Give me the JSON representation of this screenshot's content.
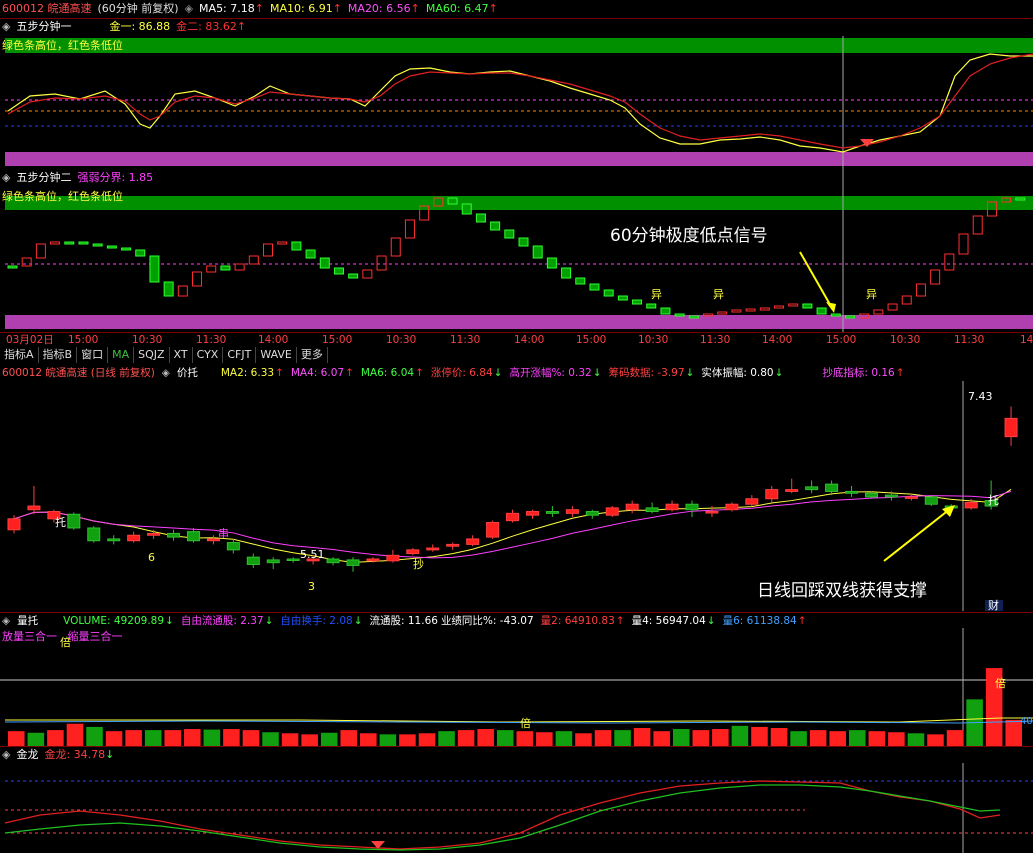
{
  "top_header": {
    "code": "600012 皖通高速",
    "period": "(60分钟 前复权)",
    "ma5": "MA5: 7.18",
    "ma10": "MA10: 6.91",
    "ma20": "MA20: 6.56",
    "ma60": "MA60: 6.47"
  },
  "pane1": {
    "title": "五步分钟一",
    "jin1": "金一: 86.88",
    "jin2": "金二: 83.62",
    "note": "绿色条高位，红色条低位"
  },
  "pane2": {
    "title": "五步分钟二",
    "strong": "强弱分界: 1.85",
    "note": "绿色条高位，红色条低位",
    "annotation": "60分钟极度低点信号",
    "marks": [
      "异",
      "异",
      "异"
    ]
  },
  "time_axis": [
    "03月02日",
    "15:00",
    "10:30",
    "11:30",
    "14:00",
    "15:00",
    "10:30",
    "11:30",
    "14:00",
    "15:00",
    "10:30",
    "11:30",
    "14:00",
    "15:00",
    "10:30",
    "11:30",
    "14"
  ],
  "tabs": [
    "指标A",
    "指标B",
    "窗口",
    "MA",
    "SQJZ",
    "XT",
    "CYX",
    "CFJT",
    "WAVE",
    "更多"
  ],
  "main_header": {
    "code": "600012 皖通高速 (日线 前复权)",
    "pt": "价托",
    "ma2": "MA2: 6.33",
    "ma4": "MA4: 6.07",
    "ma6": "MA6: 6.04",
    "zt": "涨停价: 6.84",
    "gk": "高开涨幅%: 0.32",
    "cm": "筹码数据: -3.97",
    "st": "实体振幅: 0.80",
    "cd": "抄底指标: 0.16"
  },
  "main_labels": {
    "high": "7.43",
    "low": "5.51",
    "t1": "托",
    "t2": "托",
    "chuan": "串",
    "chao": "抄",
    "n6": "6",
    "n3": "3",
    "cai": "财",
    "annotation": "日线回踩双线获得支撑"
  },
  "vol_header": {
    "title": "量托",
    "volume": "VOLUME: 49209.89",
    "ziyou": "自由流通股: 2.37",
    "huanshou": "自由换手: 2.08",
    "liutong": "流通股: 11.66",
    "yeji": "业绩同比%: -43.07",
    "l2": "量2: 64910.83",
    "l4": "量4: 56947.04",
    "l6": "量6: 61138.84",
    "sub": "放量三合一 , 缩量三合一",
    "bei1": "倍",
    "bei2": "倍",
    "bei3": "倍",
    "val40": "40"
  },
  "jl_header": {
    "title": "金龙",
    "jl": "金龙: 34.78"
  },
  "chart_data": {
    "type": "candlestick",
    "title": "600012 皖通高速 (日线 前复权)",
    "price_range": [
      5.3,
      7.6
    ],
    "daily_candles": [
      [
        6.08,
        6.2,
        6.04,
        6.24
      ],
      [
        6.3,
        6.34,
        6.25,
        6.56
      ],
      [
        6.2,
        6.28,
        6.16,
        6.3
      ],
      [
        6.25,
        6.1,
        6.08,
        6.27
      ],
      [
        6.1,
        5.96,
        5.94,
        6.12
      ],
      [
        5.98,
        5.96,
        5.92,
        6.02
      ],
      [
        5.96,
        6.02,
        5.94,
        6.06
      ],
      [
        6.02,
        6.04,
        5.98,
        6.08
      ],
      [
        6.04,
        6.0,
        5.96,
        6.08
      ],
      [
        6.06,
        5.96,
        5.94,
        6.1
      ],
      [
        5.96,
        5.98,
        5.92,
        6.02
      ],
      [
        5.94,
        5.86,
        5.82,
        5.98
      ],
      [
        5.78,
        5.7,
        5.66,
        5.82
      ],
      [
        5.75,
        5.72,
        5.65,
        5.78
      ],
      [
        5.76,
        5.75,
        5.72,
        5.78
      ],
      [
        5.74,
        5.76,
        5.7,
        5.8
      ],
      [
        5.76,
        5.72,
        5.69,
        5.78
      ],
      [
        5.75,
        5.69,
        5.62,
        5.78
      ],
      [
        5.74,
        5.76,
        5.72,
        5.78
      ],
      [
        5.74,
        5.8,
        5.72,
        5.86
      ],
      [
        5.82,
        5.86,
        5.8,
        5.88
      ],
      [
        5.86,
        5.88,
        5.84,
        5.92
      ],
      [
        5.9,
        5.92,
        5.86,
        5.94
      ],
      [
        5.92,
        5.98,
        5.9,
        6.02
      ],
      [
        6.0,
        6.16,
        5.98,
        6.18
      ],
      [
        6.18,
        6.26,
        6.16,
        6.3
      ],
      [
        6.24,
        6.28,
        6.2,
        6.3
      ],
      [
        6.28,
        6.26,
        6.22,
        6.34
      ],
      [
        6.26,
        6.3,
        6.22,
        6.34
      ],
      [
        6.28,
        6.24,
        6.2,
        6.3
      ],
      [
        6.24,
        6.32,
        6.22,
        6.34
      ],
      [
        6.3,
        6.36,
        6.26,
        6.4
      ],
      [
        6.32,
        6.28,
        6.26,
        6.38
      ],
      [
        6.3,
        6.36,
        6.28,
        6.4
      ],
      [
        6.36,
        6.3,
        6.22,
        6.4
      ],
      [
        6.28,
        6.28,
        6.22,
        6.34
      ],
      [
        6.3,
        6.36,
        6.28,
        6.38
      ],
      [
        6.36,
        6.42,
        6.34,
        6.46
      ],
      [
        6.42,
        6.52,
        6.38,
        6.56
      ],
      [
        6.5,
        6.52,
        6.48,
        6.64
      ],
      [
        6.55,
        6.52,
        6.48,
        6.62
      ],
      [
        6.58,
        6.5,
        6.46,
        6.62
      ],
      [
        6.5,
        6.48,
        6.44,
        6.56
      ],
      [
        6.48,
        6.44,
        6.42,
        6.5
      ],
      [
        6.46,
        6.44,
        6.4,
        6.5
      ],
      [
        6.44,
        6.44,
        6.4,
        6.48
      ],
      [
        6.44,
        6.36,
        6.34,
        6.46
      ],
      [
        6.34,
        6.32,
        6.3,
        6.36
      ],
      [
        6.32,
        6.38,
        6.3,
        6.42
      ],
      [
        6.4,
        6.34,
        6.3,
        6.62
      ],
      [
        7.1,
        7.3,
        7.0,
        7.43
      ]
    ],
    "volume_range": [
      0,
      200000
    ],
    "volume": [
      28000,
      25000,
      30000,
      42000,
      36000,
      28000,
      30000,
      30000,
      30000,
      32000,
      31000,
      32000,
      30000,
      26000,
      24000,
      22000,
      25000,
      30000,
      24000,
      22000,
      22000,
      24000,
      28000,
      30000,
      32000,
      30000,
      28000,
      26000,
      28000,
      24000,
      30000,
      30000,
      34000,
      28000,
      32000,
      30000,
      32000,
      38000,
      36000,
      34000,
      28000,
      30000,
      28000,
      30000,
      28000,
      26000,
      24000,
      22000,
      30000,
      88000,
      147000,
      49210
    ]
  }
}
